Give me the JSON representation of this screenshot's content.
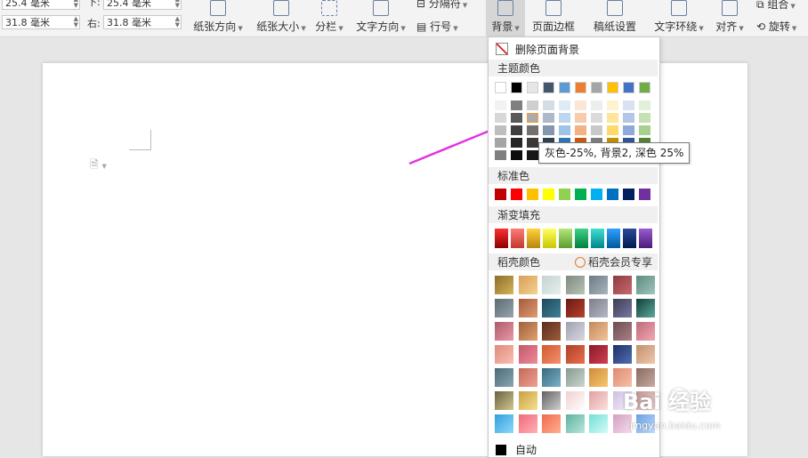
{
  "margins": {
    "top_value": "25.4 毫米",
    "bottom_label": "下:",
    "bottom_value": "25.4 毫米",
    "left_value": "31.8 毫米",
    "right_label": "右:",
    "right_value": "31.8 毫米"
  },
  "ribbon": {
    "orientation": "纸张方向",
    "size": "纸张大小",
    "columns": "分栏",
    "text_direction": "文字方向",
    "separator": "分隔符",
    "line_number": "行号",
    "background": "背景",
    "page_border": "页面边框",
    "draft_settings": "稿纸设置",
    "text_wrap": "文字环绕",
    "align": "对齐",
    "group": "组合",
    "rotate": "旋转"
  },
  "dropdown": {
    "remove_background": "删除页面背景",
    "theme_colors_title": "主题颜色",
    "standard_colors_title": "标准色",
    "gradient_title": "渐变填充",
    "preset_title": "稻壳颜色",
    "vip_label": "稻壳会员专享",
    "auto_label": "自动",
    "theme_row": [
      "#ffffff",
      "#000000",
      "#e7e6e6",
      "#44546a",
      "#5b9bd5",
      "#ed7d31",
      "#a5a5a5",
      "#ffc000",
      "#4472c4",
      "#70ad47"
    ],
    "tints": [
      [
        "#f2f2f2",
        "#7f7f7f",
        "#d0cece",
        "#d6dce4",
        "#deebf6",
        "#fbe5d5",
        "#ededed",
        "#fff2cc",
        "#d9e2f3",
        "#e2efd9"
      ],
      [
        "#d8d8d8",
        "#595959",
        "#aeaaaa",
        "#adb9ca",
        "#bdd7ee",
        "#f7cbac",
        "#dbdbdb",
        "#fee599",
        "#b4c6e7",
        "#c5e0b3"
      ],
      [
        "#bfbfbf",
        "#3f3f3f",
        "#757070",
        "#8496b0",
        "#9dc3e6",
        "#f4b183",
        "#c9c9c9",
        "#ffd965",
        "#8eaadb",
        "#a8d08d"
      ],
      [
        "#a5a5a5",
        "#262626",
        "#3a3838",
        "#323f4f",
        "#2e75b5",
        "#c55a11",
        "#7b7b7b",
        "#bf9000",
        "#2f5496",
        "#538135"
      ],
      [
        "#7f7f7f",
        "#0c0c0c",
        "#171616",
        "#222a35",
        "#1e4e79",
        "#833c0b",
        "#525252",
        "#7f6000",
        "#1f3864",
        "#375623"
      ]
    ],
    "standard": [
      "#c00000",
      "#ff0000",
      "#ffc000",
      "#ffff00",
      "#92d050",
      "#00b050",
      "#00b0f0",
      "#0070c0",
      "#002060",
      "#7030a0"
    ],
    "gradients": [
      [
        "#8b0000",
        "#ff3030"
      ],
      [
        "#c0392b",
        "#ff7b7b"
      ],
      [
        "#b8860b",
        "#ffd23f"
      ],
      [
        "#c8c800",
        "#ffff66"
      ],
      [
        "#5a9e2f",
        "#b6e57c"
      ],
      [
        "#00803c",
        "#3fd08a"
      ],
      [
        "#00868b",
        "#40e0d0"
      ],
      [
        "#005a9c",
        "#2fa0ff"
      ],
      [
        "#001a4d",
        "#2c4a9a"
      ],
      [
        "#4b1a7a",
        "#9a5cd0"
      ]
    ],
    "presets": [
      [
        [
          "#8a6d2a",
          "#d6b45a"
        ],
        [
          "#d8a05a",
          "#f3d190"
        ],
        [
          "#c3d3d0",
          "#e7efee"
        ],
        [
          "#7d8a7e",
          "#b9c3b8"
        ],
        [
          "#6b7a85",
          "#a8b6bf"
        ],
        [
          "#8c3b3f",
          "#c96a6f"
        ],
        [
          "#5c8a7f",
          "#9fc7bc"
        ]
      ],
      [
        [
          "#5c6a72",
          "#97a6ae"
        ],
        [
          "#a45a3a",
          "#e09a74"
        ],
        [
          "#1f4a5c",
          "#3e7f95"
        ],
        [
          "#6a1a10",
          "#b84030"
        ],
        [
          "#7d7f8c",
          "#b5b7c4"
        ],
        [
          "#3e3e55",
          "#7878a0"
        ],
        [
          "#0f3f3a",
          "#5ea89a"
        ]
      ],
      [
        [
          "#b05a6a",
          "#e79aa5"
        ],
        [
          "#a0603a",
          "#e0a070"
        ],
        [
          "#5a2e1e",
          "#a05a3a"
        ],
        [
          "#a0a0b0",
          "#d8d8e4"
        ],
        [
          "#c48a5a",
          "#f0c49a"
        ],
        [
          "#6e4e52",
          "#a88086"
        ],
        [
          "#c06a78",
          "#f0a8b2"
        ]
      ],
      [
        [
          "#e08a7a",
          "#f8c0b4"
        ],
        [
          "#c05a6a",
          "#f08a9a"
        ],
        [
          "#d05a30",
          "#f79070"
        ],
        [
          "#b0402a",
          "#e8704a"
        ],
        [
          "#8a1a2a",
          "#d04050"
        ],
        [
          "#20306a",
          "#5070b0"
        ],
        [
          "#c09070",
          "#f0c8aa"
        ]
      ],
      [
        [
          "#4a6a76",
          "#8aa6b2"
        ],
        [
          "#c46a5a",
          "#f0a090"
        ],
        [
          "#3a6a80",
          "#7ab0c8"
        ],
        [
          "#8a9a90",
          "#c8d6cc"
        ],
        [
          "#d08a3a",
          "#f6c870"
        ],
        [
          "#e08a70",
          "#f6c0a8"
        ],
        [
          "#8a6a60",
          "#c8aaa0"
        ]
      ],
      [
        [
          "#6a6040",
          "#d0c890"
        ],
        [
          "#c8a040",
          "#f6e090"
        ],
        [
          "#606060",
          "#d0d0d0"
        ],
        [
          "#f0d0d0",
          "#ffffff"
        ],
        [
          "#e0a0a0",
          "#fbe0e0"
        ],
        [
          "#d0c0e0",
          "#f4ecfa"
        ],
        [
          "#c09090",
          "#f0d8d8"
        ]
      ],
      [
        [
          "#30a0d8",
          "#90d8ff"
        ],
        [
          "#f06a7a",
          "#ffb0b8"
        ],
        [
          "#f06a4a",
          "#ffb094"
        ],
        [
          "#60b0a0",
          "#b8e8dc"
        ],
        [
          "#70e0d8",
          "#d4fbf6"
        ],
        [
          "#d0a0c0",
          "#f6dcec"
        ],
        [
          "#6aa0e0",
          "#c0dcfc"
        ]
      ]
    ]
  },
  "tooltip": "灰色-25%, 背景2, 深色 25%",
  "watermark": {
    "main": "Bai 经验",
    "sub": "jingyan.baidu.com"
  }
}
